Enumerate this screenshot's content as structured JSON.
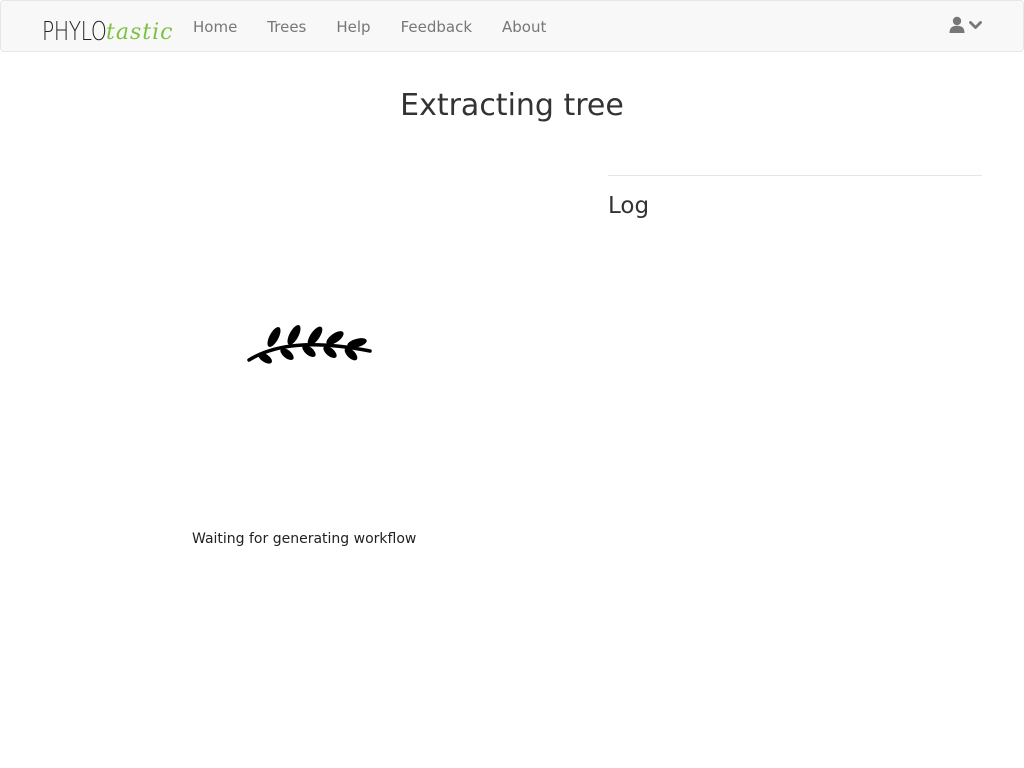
{
  "brand": {
    "part1": "PHYLO",
    "part2": "tastic",
    "accent_color": "#7dc242"
  },
  "nav": {
    "items": [
      {
        "label": "Home"
      },
      {
        "label": "Trees"
      },
      {
        "label": "Help"
      },
      {
        "label": "Feedback"
      },
      {
        "label": "About"
      }
    ]
  },
  "user_menu": {
    "icons": [
      "user-icon",
      "chevron-down-icon"
    ]
  },
  "main": {
    "title": "Extracting tree",
    "status": "Waiting for generating workflow",
    "spinner_icon": "leaf-branch-icon"
  },
  "log": {
    "title": "Log",
    "entries": []
  }
}
